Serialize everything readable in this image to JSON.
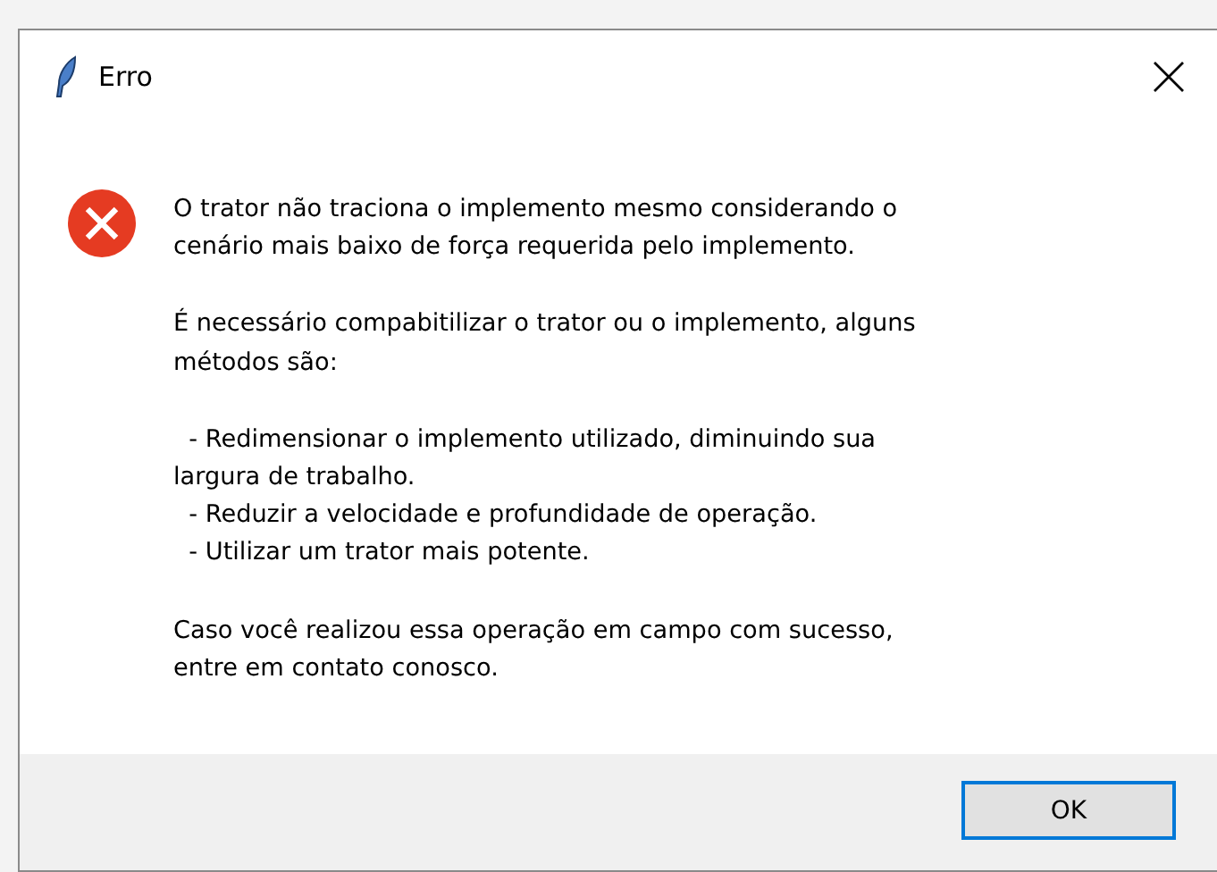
{
  "window": {
    "title": "Erro"
  },
  "message": {
    "paragraphs": [
      "O trator não traciona o implemento mesmo considerando o\ncenário mais baixo de força requerida pelo implemento.",
      "É necessário compabitilizar o trator ou o implemento, alguns\nmétodos são:",
      "  - Redimensionar o implemento utilizado, diminuindo sua\nlargura de trabalho.\n  - Reduzir a velocidade e profundidade de operação.\n  - Utilizar um trator mais potente.",
      "Caso você realizou essa operação em campo com sucesso,\nentre em contato conosco."
    ]
  },
  "buttons": [
    {
      "label": "OK",
      "selected": true
    }
  ]
}
